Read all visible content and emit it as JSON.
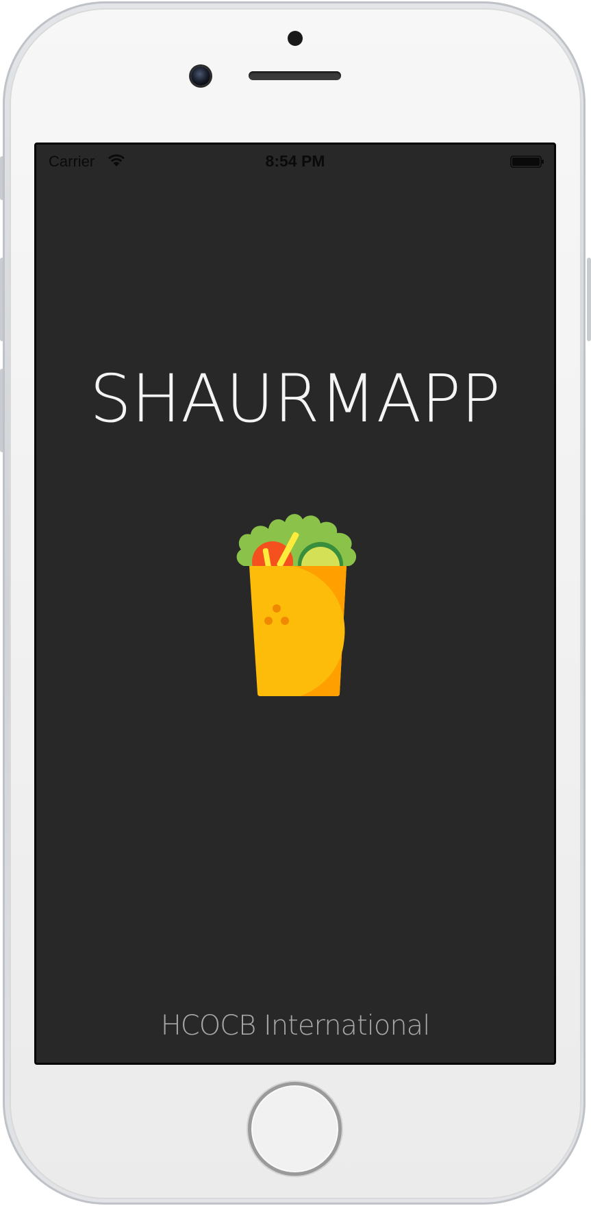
{
  "status_bar": {
    "carrier": "Carrier",
    "time": "8:54 PM",
    "wifi_icon": "wifi-icon",
    "battery_icon": "battery-full-icon"
  },
  "app": {
    "title": "SHAURMAPP",
    "logo_icon": "shawarma-wrap-icon",
    "footer": "HCOCB International"
  },
  "colors": {
    "screen_background": "#282828",
    "title_text": "#ffffff",
    "footer_text": "#a8a8a8",
    "wrap_yellow": "#fdbb0a",
    "wrap_orange": "#ff9f00",
    "lettuce_green": "#8bc34a",
    "tomato_red": "#f4511e",
    "cucumber": "#d4e157"
  },
  "device": {
    "frame": "iphone-frame",
    "home_button_icon": "home-button-icon"
  }
}
